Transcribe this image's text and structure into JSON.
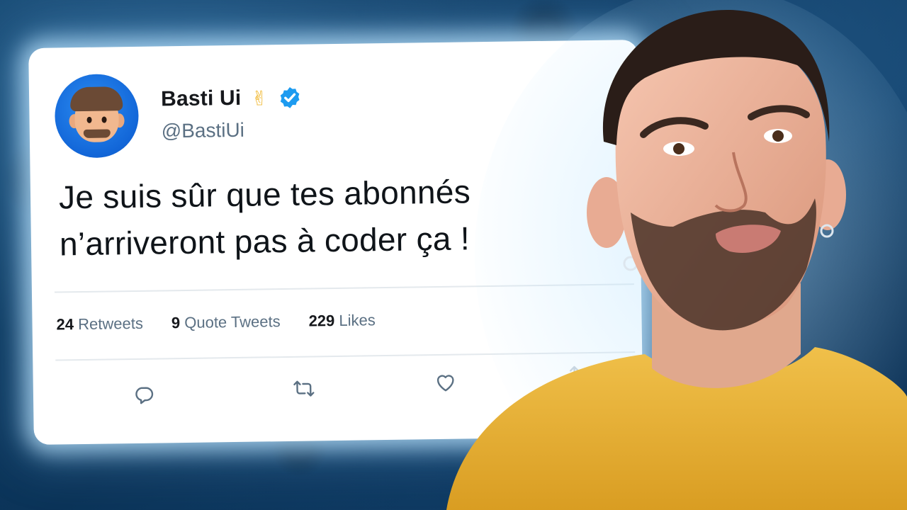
{
  "tweet": {
    "display_name": "Basti Ui",
    "name_emoji": "✌",
    "handle": "@BastiUi",
    "text_line1": "Je suis sûr que tes abonnés",
    "text_line2": "n’arriveront pas à coder ça !",
    "stats": [
      {
        "count": "24",
        "label": "Retweets"
      },
      {
        "count": "9",
        "label": "Quote Tweets"
      },
      {
        "count": "229",
        "label": "Likes"
      }
    ]
  },
  "icons": [
    "verified-badge-icon",
    "reply-icon",
    "retweet-icon",
    "like-icon",
    "share-icon"
  ],
  "colors": {
    "background": "#0f3f66",
    "card": "#ffffff",
    "verified": "#1d9bf0",
    "shirt": "#e8b43a",
    "secondary_text": "#5b7083"
  }
}
